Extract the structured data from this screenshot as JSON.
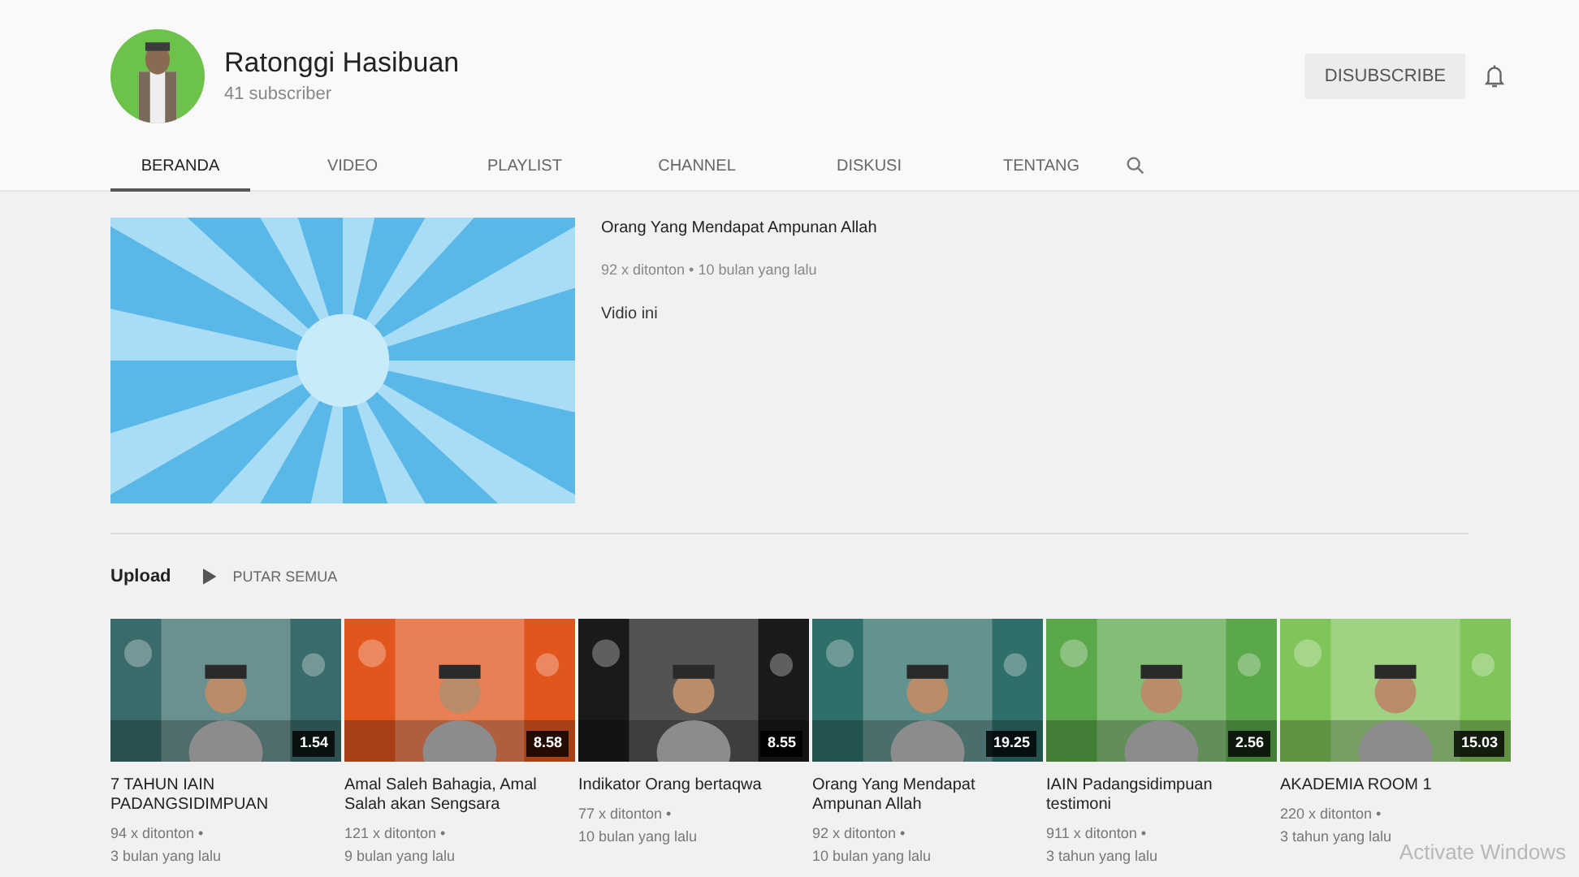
{
  "channel": {
    "name": "Ratonggi Hasibuan",
    "subscribers": "41 subscriber",
    "subscribe_button": "DISUBSCRIBE"
  },
  "tabs": [
    {
      "label": "BERANDA",
      "selected": true
    },
    {
      "label": "VIDEO",
      "selected": false
    },
    {
      "label": "PLAYLIST",
      "selected": false
    },
    {
      "label": "CHANNEL",
      "selected": false
    },
    {
      "label": "DISKUSI",
      "selected": false
    },
    {
      "label": "TENTANG",
      "selected": false
    }
  ],
  "featured": {
    "title": "Orang Yang Mendapat Ampunan Allah",
    "meta": "92 x ditonton • 10 bulan yang lalu",
    "description": "Vidio ini"
  },
  "uploads": {
    "title": "Upload",
    "play_all": "PUTAR SEMUA",
    "videos": [
      {
        "title": "7 TAHUN IAIN PADANGSIDIMPUAN",
        "duration": "1.54",
        "views": "94 x ditonton •",
        "age": "3 bulan yang lalu"
      },
      {
        "title": "Amal Saleh Bahagia, Amal Salah akan Sengsara",
        "duration": "8.58",
        "views": "121 x ditonton •",
        "age": "9 bulan yang lalu"
      },
      {
        "title": "Indikator Orang bertaqwa",
        "duration": "8.55",
        "views": "77 x ditonton •",
        "age": "10 bulan yang lalu"
      },
      {
        "title": "Orang Yang Mendapat Ampunan Allah",
        "duration": "19.25",
        "views": "92 x ditonton •",
        "age": "10 bulan yang lalu"
      },
      {
        "title": "IAIN Padangsidimpuan testimoni",
        "duration": "2.56",
        "views": "911 x ditonton •",
        "age": "3 tahun yang lalu"
      },
      {
        "title": "AKADEMIA ROOM 1",
        "duration": "15.03",
        "views": "220 x ditonton •",
        "age": "3 tahun yang lalu"
      }
    ]
  },
  "os_notice": "Activate Windows"
}
